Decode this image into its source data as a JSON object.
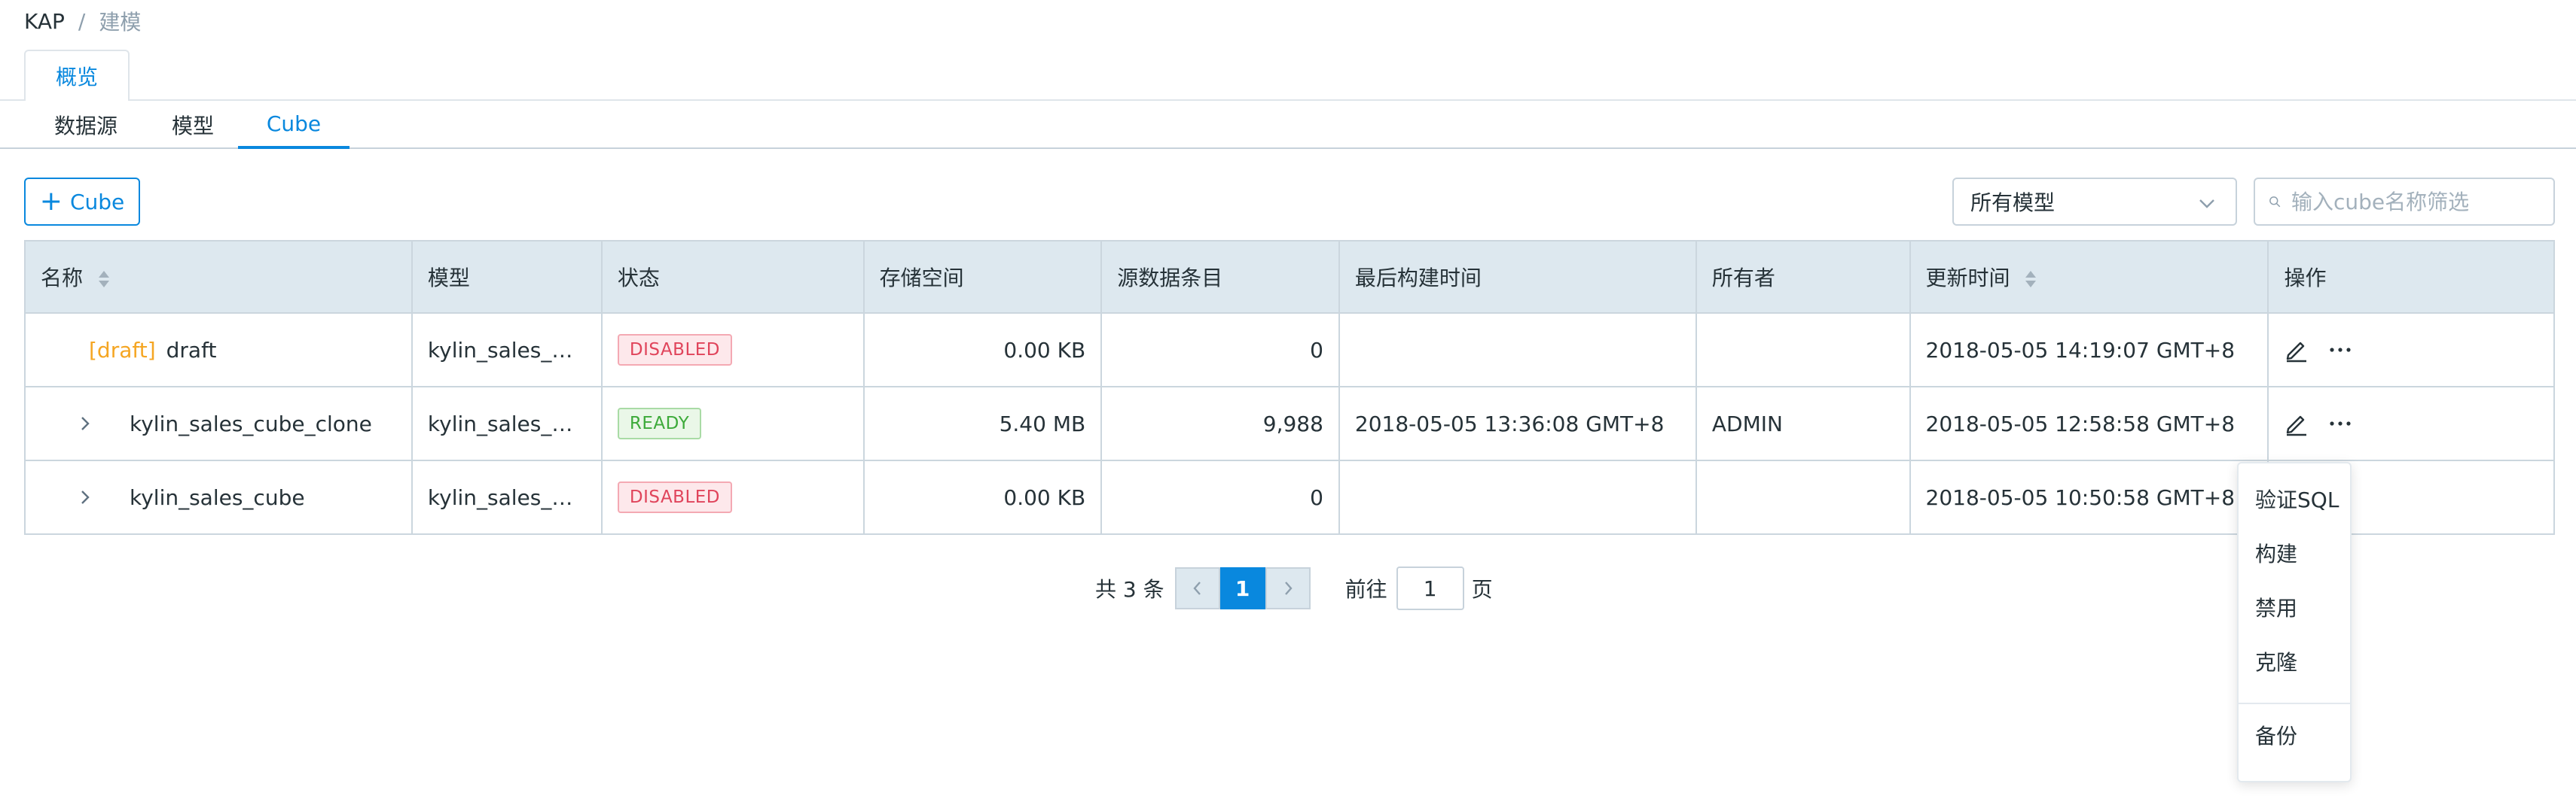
{
  "breadcrumb": {
    "root": "KAP",
    "separator": "/",
    "current": "建模"
  },
  "top_tab": {
    "label": "概览"
  },
  "sub_tabs": [
    {
      "label": "数据源",
      "active": false
    },
    {
      "label": "模型",
      "active": false
    },
    {
      "label": "Cube",
      "active": true
    }
  ],
  "toolbar": {
    "add_label": "Cube",
    "model_filter": "所有模型",
    "search_placeholder": "输入cube名称筛选"
  },
  "table": {
    "headers": {
      "name": "名称",
      "model": "模型",
      "status": "状态",
      "storage": "存储空间",
      "source_records": "源数据条目",
      "last_build": "最后构建时间",
      "owner": "所有者",
      "updated": "更新时间",
      "actions": "操作"
    },
    "rows": [
      {
        "draft_tag": "[draft]",
        "name": "draft",
        "model": "kylin_sales_m...",
        "status": "DISABLED",
        "storage": "0.00 KB",
        "source_records": "0",
        "last_build": "",
        "owner": "",
        "updated": "2018-05-05 14:19:07 GMT+8"
      },
      {
        "draft_tag": "",
        "name": "kylin_sales_cube_clone",
        "model": "kylin_sales_m...",
        "status": "READY",
        "storage": "5.40 MB",
        "source_records": "9,988",
        "last_build": "2018-05-05 13:36:08 GMT+8",
        "owner": "ADMIN",
        "updated": "2018-05-05 12:58:58 GMT+8"
      },
      {
        "draft_tag": "",
        "name": "kylin_sales_cube",
        "model": "kylin_sales_m...",
        "status": "DISABLED",
        "storage": "0.00 KB",
        "source_records": "0",
        "last_build": "",
        "owner": "",
        "updated": "2018-05-05 10:50:58 GMT+8"
      }
    ]
  },
  "pagination": {
    "total_text": "共 3 条",
    "current_page": "1",
    "goto_label": "前往",
    "goto_value": "1",
    "page_unit": "页"
  },
  "action_menu": {
    "items": [
      "验证SQL",
      "构建",
      "禁用",
      "克隆",
      "备份"
    ]
  },
  "colors": {
    "accent": "#0988de",
    "header_bg": "#dde8ef",
    "draft": "#f5a623",
    "disabled": "#e0445b",
    "ready": "#3daa3a"
  },
  "icons": {
    "add": "plus-icon",
    "search": "search-icon",
    "dropdown": "chevron-down-icon",
    "sort": "sort-icon",
    "expand": "chevron-right-icon",
    "edit": "edit-pencil-icon",
    "more": "more-ellipsis-icon",
    "prev": "chevron-left-icon",
    "next": "chevron-right-icon"
  }
}
